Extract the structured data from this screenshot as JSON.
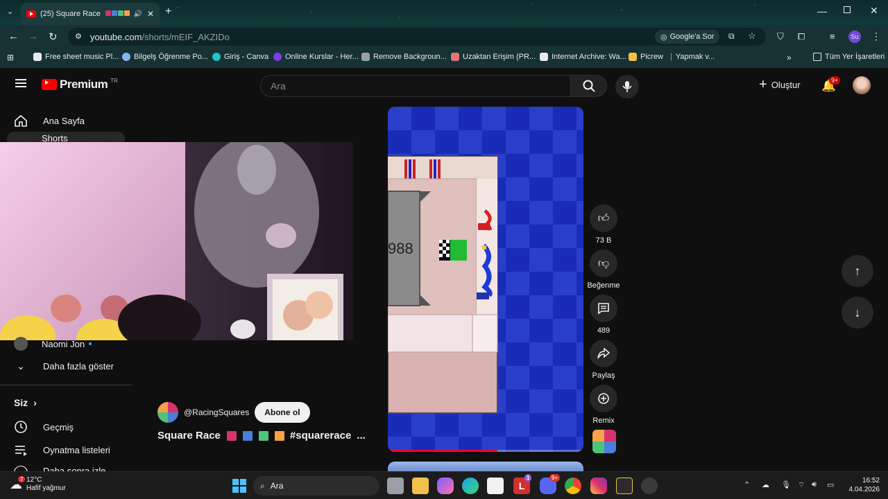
{
  "browser": {
    "tab_title": "(25) Square Race",
    "tab_squares": [
      "#d6336c",
      "#4a7fd8",
      "#4fc27a",
      "#f5a24a"
    ],
    "url_host": "youtube.com",
    "url_path": "/shorts/mEIF_AKZIDo",
    "google_ask": "Google'a Sor",
    "profile_initial": "Su"
  },
  "bookmarks": [
    {
      "label": "Free sheet music Pl...",
      "color": "#e8eaed"
    },
    {
      "label": "Bilgelş Öğrenme Po...",
      "color": "#8ab4f8"
    },
    {
      "label": "Giriş - Canva",
      "color": "#20c4cb"
    },
    {
      "label": "Online Kurslar - Her...",
      "color": "#7b3fe4"
    },
    {
      "label": "Remove Backgroun...",
      "color": "#9aa0a6"
    },
    {
      "label": "Uzaktan Erişim (PR...",
      "color": "#e57373"
    },
    {
      "label": "Internet Archive: Wa...",
      "color": "#e8eaed"
    },
    {
      "label": "Picrew",
      "color": "#f6c143"
    },
    {
      "label": "Yapmak v...",
      "color": "#9aa0a6"
    }
  ],
  "all_bookmarks": "Tüm Yer İşaretleri",
  "youtube": {
    "logo": "Premium",
    "logo_region": "TR",
    "search_placeholder": "Ara",
    "create_label": "Oluştur",
    "notif_count": "9+"
  },
  "sidebar": {
    "home": "Ana Sayfa",
    "shorts": "Shorts",
    "sub_user": "Naomi Jon",
    "show_more": "Daha fazla göster",
    "you": "Siz",
    "history": "Geçmiş",
    "playlists": "Oynatma listeleri",
    "your_videos": "Daha sonra izle"
  },
  "short": {
    "channel": "@RacingSquares",
    "subscribe": "Abone ol",
    "title": "Square Race",
    "hashtag": "#squarerace",
    "ellipsis": "...",
    "game_number": "988",
    "progress": 0.56
  },
  "actions": {
    "likes": "73 B",
    "dislike": "Beğenme",
    "comments": "489",
    "share": "Paylaş",
    "remix": "Remix"
  },
  "taskbar": {
    "weather_temp": "12°C",
    "weather_desc": "Hafif yağmur",
    "weather_badge": "7",
    "search": "Ara",
    "time": "16:52",
    "date": "4.04.2026",
    "app_badge_l": "1",
    "app_badge_discord": "9+"
  }
}
